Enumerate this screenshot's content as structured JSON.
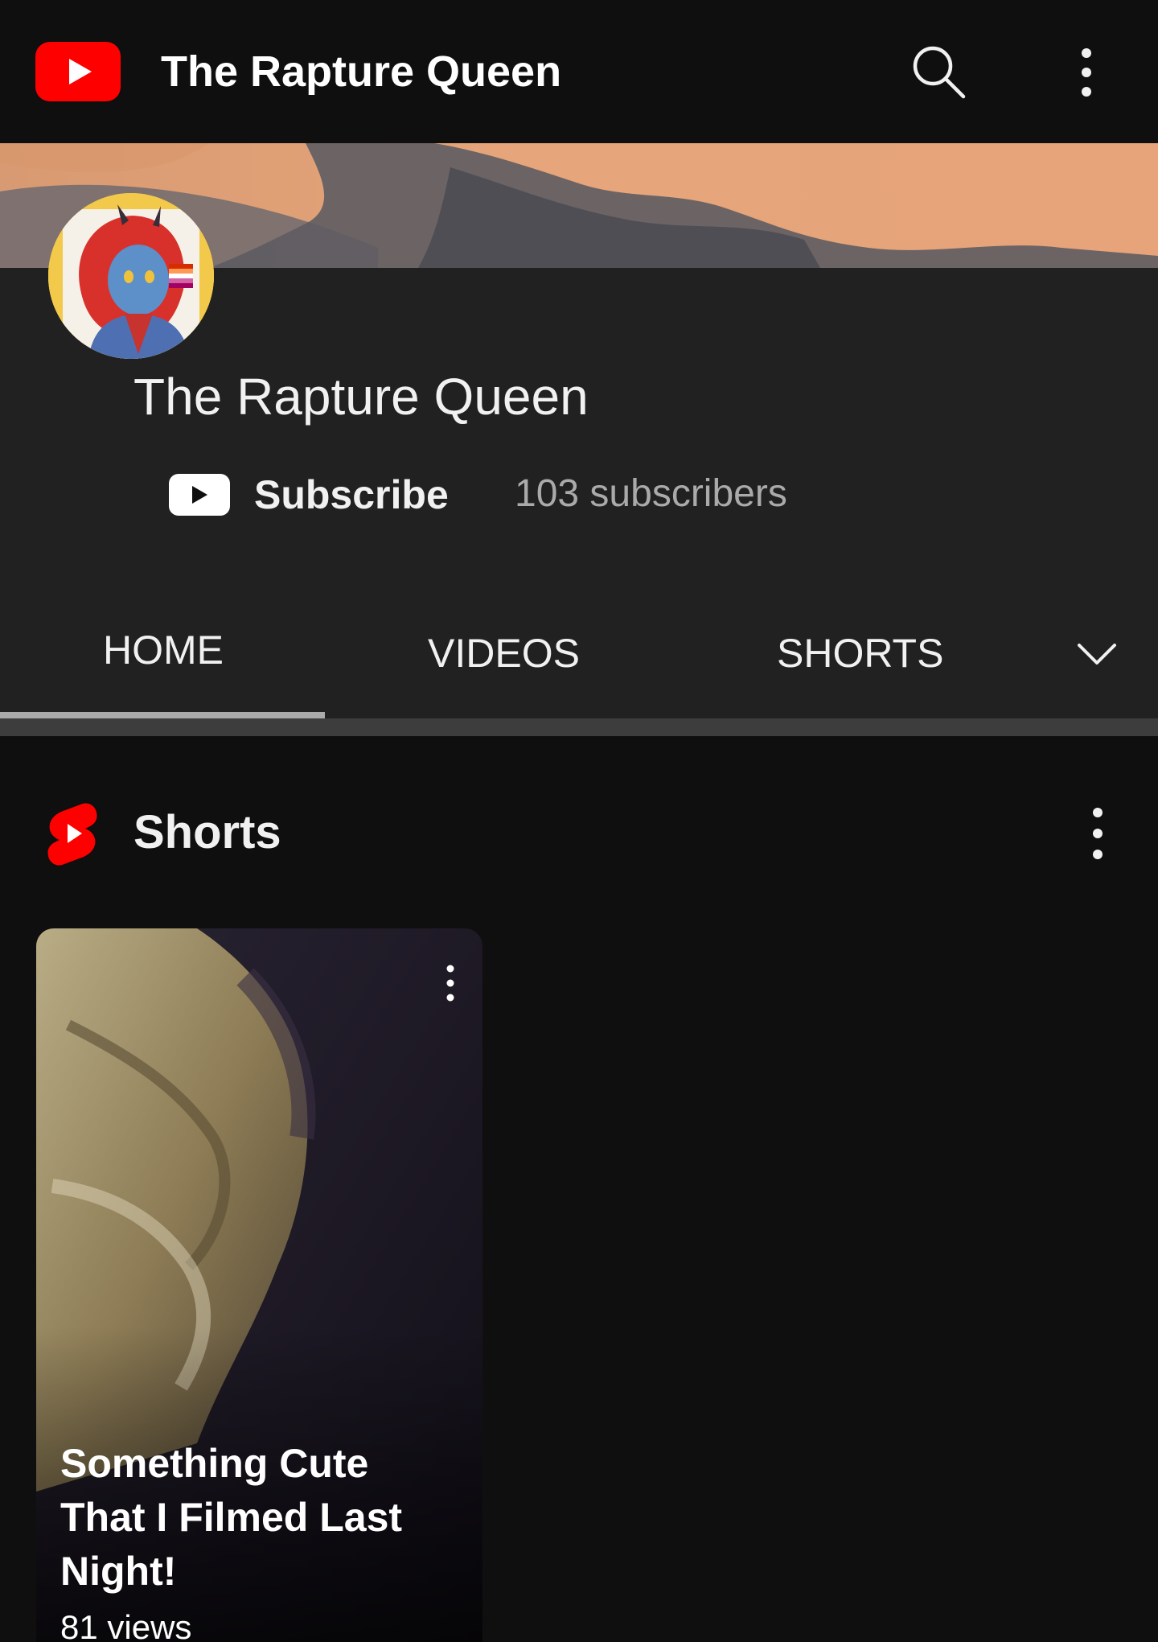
{
  "topbar": {
    "title": "The Rapture Queen",
    "logo_icon": "youtube-logo-icon",
    "search_icon": "search-icon",
    "more_icon": "more-vertical-icon"
  },
  "channel": {
    "name": "The Rapture Queen",
    "subscribe_label": "Subscribe",
    "subscriber_count": "103 subscribers"
  },
  "tabs": {
    "items": [
      {
        "label": "HOME",
        "active": true
      },
      {
        "label": "VIDEOS",
        "active": false
      },
      {
        "label": "SHORTS",
        "active": false
      }
    ],
    "more_icon": "chevron-down-icon"
  },
  "shorts_section": {
    "title": "Shorts",
    "icon": "shorts-icon",
    "items": [
      {
        "title": "Something Cute That I Filmed Last Night!",
        "views": "81 views"
      }
    ]
  },
  "colors": {
    "brand_red": "#ff0000",
    "background": "#0f0f0f",
    "header_background": "#212121",
    "secondary_text": "#aaaaaa"
  }
}
